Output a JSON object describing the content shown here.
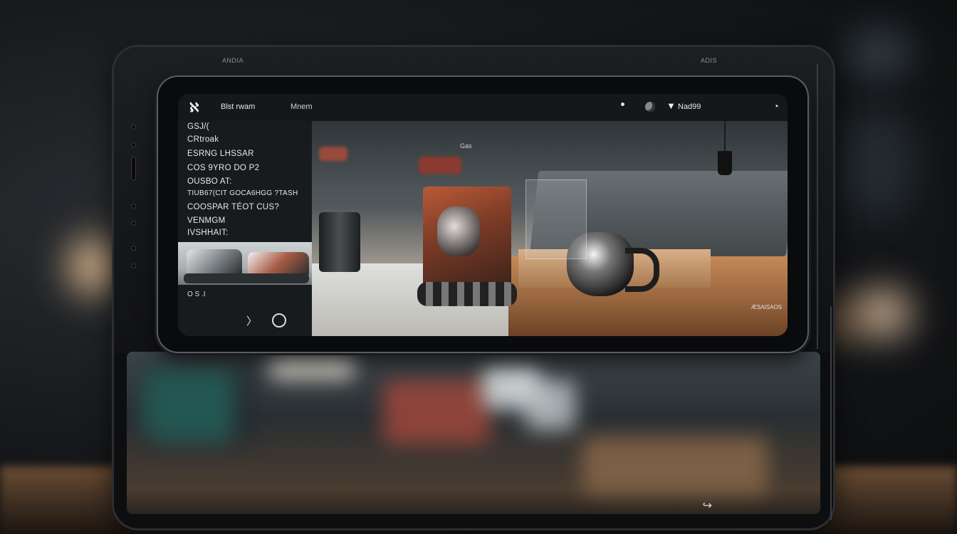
{
  "app": {
    "title": "Blst rwam",
    "menu_label": "Mnem",
    "status_text": "Nad99",
    "icons": {
      "logo": "app-logo-icon",
      "wifi": "wifi-icon",
      "mic": "mic-icon",
      "moon": "moon-icon",
      "back": "back-icon",
      "home": "home-circle-icon"
    }
  },
  "sidebar": {
    "items": [
      {
        "label": "GSJ/("
      },
      {
        "label": "CRtroak"
      },
      {
        "label": "ESRNG LHSSAR"
      },
      {
        "label": "COS 9YRO DO P2"
      },
      {
        "label": "OUSBO AT:"
      },
      {
        "label": "TIUB67(CIT GOCA6HGG ?TASH"
      },
      {
        "label": "COOSPAR TÉOT CUS?"
      },
      {
        "label": "VENMGM"
      },
      {
        "label": "IVSHHAIT:"
      }
    ],
    "footer": "O S .I"
  },
  "photo": {
    "glass_label": "Gas",
    "caption": "ÆSAISAOS"
  },
  "background": {
    "back_caption_left": "ANDIA",
    "back_caption_right": "ADIS"
  },
  "colors": {
    "wood": "#b5784a",
    "accent_red": "#c0442e",
    "bokeh": "#e9c9a3"
  }
}
